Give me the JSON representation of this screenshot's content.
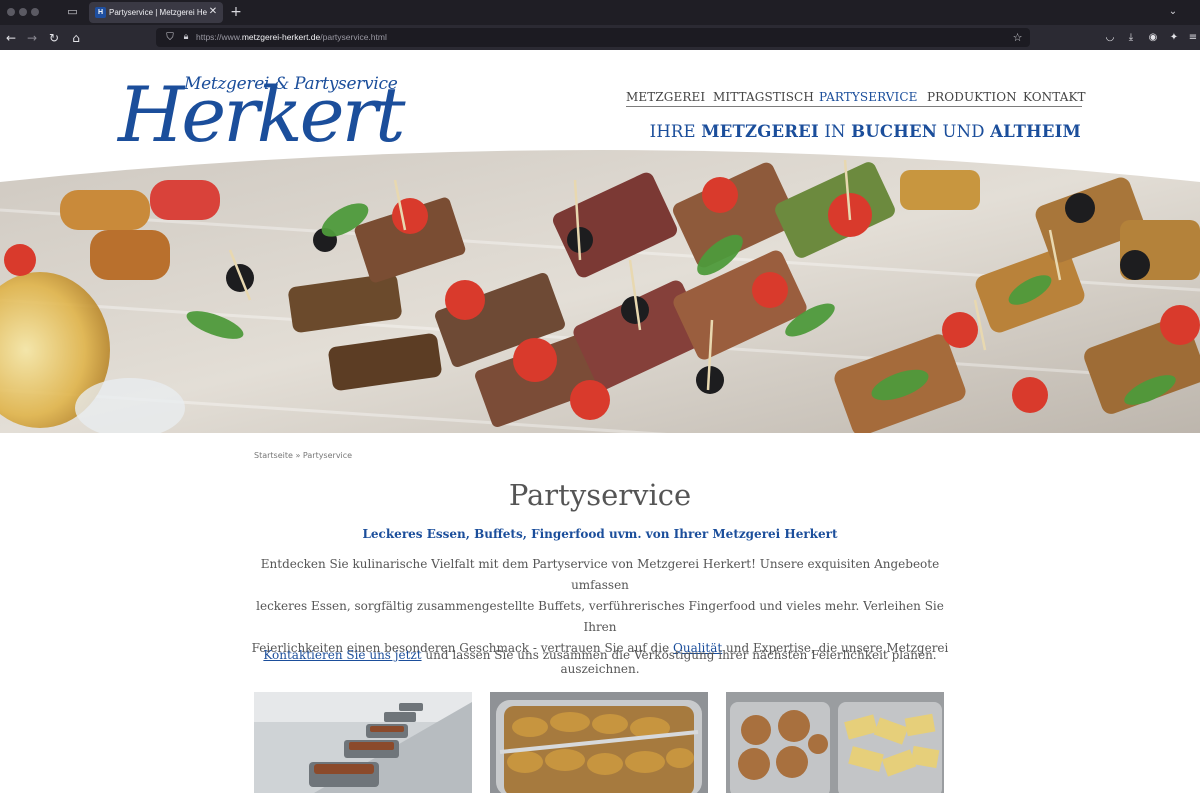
{
  "browser": {
    "tab_title": "Partyservice | Metzgerei Herkert",
    "tab_favicon_text": "H",
    "tab_close": "✕",
    "new_tab": "+",
    "url_scheme": "https://www.",
    "url_host": "metzgerei-herkert.de",
    "url_path": "/partyservice.html"
  },
  "site": {
    "logo_subtitle": "Metzgerei & Partyservice",
    "logo_name": "Herkert",
    "nav": [
      "METZGEREI",
      "MITTAGSTISCH",
      "PARTYSERVICE",
      "PRODUKTION",
      "KONTAKT"
    ],
    "nav_active": "PARTYSERVICE",
    "slogan": {
      "p1": "IHRE ",
      "b1": "METZGEREI",
      "p2": " IN ",
      "b2": "BUCHEN",
      "p3": " UND ",
      "b3": "ALTHEIM"
    }
  },
  "content": {
    "breadcrumb_home": "Startseite",
    "breadcrumb_sep": " » ",
    "breadcrumb_current": "Partyservice",
    "title": "Partyservice",
    "lead": "Leckeres Essen, Buffets, Fingerfood uvm. von Ihrer Metzgerei Herkert",
    "intro_line1": "Entdecken Sie kulinarische Vielfalt mit dem Partyservice von Metzgerei Herkert! Unsere exquisiten Angebeote umfassen",
    "intro_line2": "leckeres Essen, sorgfältig zusammengestellte Buffets, verführerisches Fingerfood und vieles mehr. Verleihen Sie Ihren",
    "intro_line3a": "Feierlichkeiten einen besonderen Geschmack - vertrauen Sie auf die ",
    "intro_link": "Qualität",
    "intro_line3b": " und Expertise, die unsere Metzgerei",
    "intro_line4": "auszeichnen.",
    "contact_link": "Kontaktieren Sie uns jetzt",
    "contact_rest": " und lassen Sie uns zusammen die Verköstigung ihrer nächsten Feierlichkeit planen."
  },
  "colors": {
    "brand_blue": "#1b4e9b",
    "text_gray": "#555555",
    "chrome_dark": "#1f1e25",
    "chrome_nav": "#2b2a33"
  }
}
